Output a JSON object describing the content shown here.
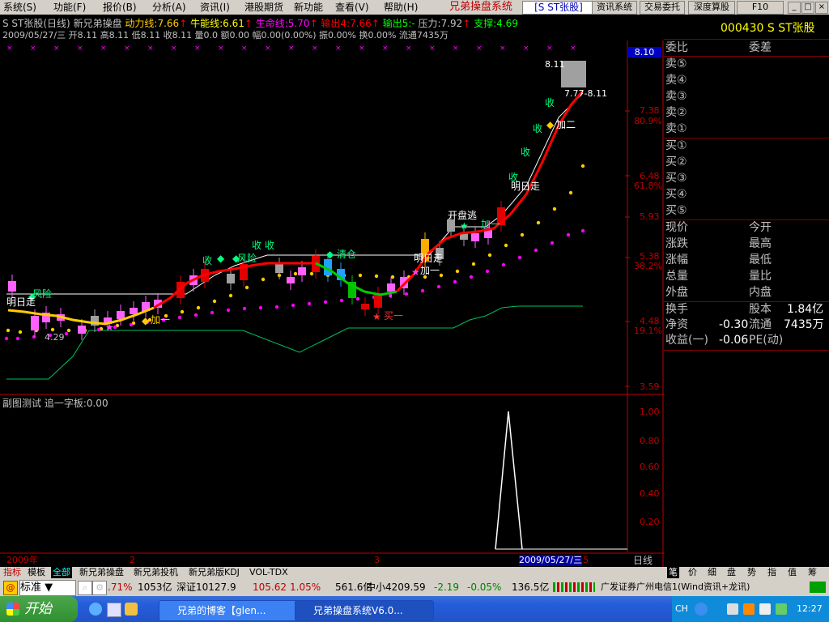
{
  "menu": {
    "items": [
      "系统(S)",
      "功能(F)",
      "报价(B)",
      "分析(A)",
      "资讯(I)",
      "港股期货",
      "新功能",
      "查看(V)",
      "帮助(H)"
    ],
    "app_title": "兄弟操盘系统",
    "stock_box": "[S ST张股]",
    "buttons": [
      "资讯系统",
      "交易委托",
      "深度算股",
      "F10"
    ],
    "window_controls": [
      "_",
      "□",
      "×"
    ]
  },
  "chart_header": {
    "line1": {
      "name": "S ST张股(日线)",
      "indicator": "新兄弟操盘",
      "dongli": "动力线:7.66",
      "niuneng": "牛能线:6.61",
      "shengming": "生命线:5.70",
      "shuchu": "输出4:7.66",
      "shuchu5": "输出5:-",
      "yali": "压力:7.92",
      "zhicheng": "支撑:4.69"
    },
    "line2": "2009/05/27/三 开8.11 高8.11 低8.11 收8.11 量0.0 额0.00 幅0.00(0.00%) 振0.00% 换0.00% 流通7435万"
  },
  "axis": {
    "price_ticks": [
      "8.10",
      "7.38",
      "80.9%",
      "6.48",
      "61.8%",
      "5.93",
      "5.38",
      "38.2%",
      "4.48",
      "19.1%",
      "3.59"
    ],
    "current_price_tag": "8.10",
    "sub_ticks": [
      "1.00",
      "0.80",
      "0.60",
      "0.40",
      "0.20"
    ],
    "x_labels": [
      "2009年",
      "2",
      "3",
      "2009/05/27/三",
      "5"
    ],
    "period": "日线"
  },
  "annotations": {
    "mingrizou1": "明日走",
    "kaipantao": "开盘逃",
    "fengxian1": "风险",
    "fengxian2": "风险",
    "qingcang": "清仓",
    "mingrizou2": "明日走",
    "mingrizou3": "明日走",
    "jia": "加一",
    "jia2": "加二",
    "mai1": "买一",
    "shou": "收",
    "low_price": "4.29",
    "high_price": "8.11",
    "high_range": "7.77-8.11",
    "peak_price": "8.11"
  },
  "sub_chart": {
    "title": "副图测试 追一字板:0.00"
  },
  "quote_panel": {
    "code_name": "000430 S ST张股",
    "weibi": "委比",
    "weicha": "委差",
    "sell": [
      "卖⑤",
      "卖④",
      "卖③",
      "卖②",
      "卖①"
    ],
    "buy": [
      "买①",
      "买②",
      "买③",
      "买④",
      "买⑤"
    ],
    "left_labels": [
      "现价",
      "涨跌",
      "涨幅",
      "总量",
      "外盘"
    ],
    "right_labels": [
      "今开",
      "最高",
      "最低",
      "量比",
      "内盘"
    ],
    "huanshou": "换手",
    "guben_label": "股本",
    "guben": "1.84亿",
    "jingzi": "净资",
    "jingzi_val": "-0.30",
    "liutong": "流通",
    "liutong_val": "7435万",
    "shouyi": "收益(一)",
    "shouyi_val": "-0.06",
    "pe": "PE(动)",
    "bottom_tabs": [
      "笔",
      "价",
      "细",
      "盘",
      "势",
      "指",
      "值",
      "筹"
    ]
  },
  "tabs": [
    "指标",
    "模板",
    "全部",
    "新兄弟操盘",
    "新兄弟投机",
    "新兄弟版KDJ",
    "VOL-TDX"
  ],
  "ticker": {
    "mode": "标准",
    "pct1": ".71%",
    "amt1": "1053亿",
    "shenzheng": "深证10127.9",
    "sz_chg": "105.62",
    "sz_pct": "1.05%",
    "sz_amt": "561.6亿",
    "zhongxiao": "中小4209.59",
    "zx_chg": "-2.19",
    "zx_pct": "-0.05%",
    "zx_amt": "136.5亿",
    "broker": "广发证券广州电信1(Wind资讯+龙讯)"
  },
  "taskbar": {
    "start": "开始",
    "tasks": [
      "兄弟的博客【glen...",
      "兄弟操盘系统V6.0..."
    ],
    "lang": "CH",
    "clock": "12:27"
  }
}
